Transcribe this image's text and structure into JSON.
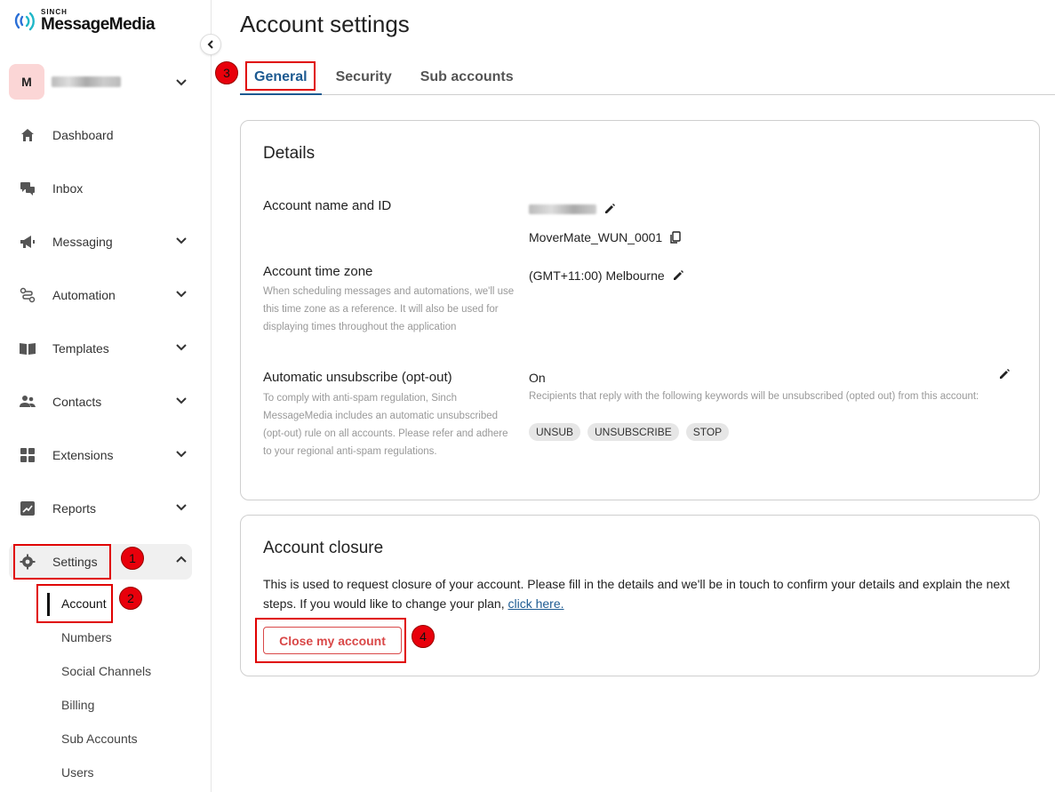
{
  "brand": {
    "small": "SINCH",
    "name": "MessageMedia"
  },
  "account_switcher": {
    "avatar_letter": "M"
  },
  "nav": {
    "items": [
      {
        "label": "Dashboard",
        "icon": "home-icon"
      },
      {
        "label": "Inbox",
        "icon": "chat-icon"
      },
      {
        "label": "Messaging",
        "icon": "megaphone-icon"
      },
      {
        "label": "Automation",
        "icon": "workflow-icon"
      },
      {
        "label": "Templates",
        "icon": "book-icon"
      },
      {
        "label": "Contacts",
        "icon": "people-icon"
      },
      {
        "label": "Extensions",
        "icon": "grid-icon"
      },
      {
        "label": "Reports",
        "icon": "chart-icon"
      },
      {
        "label": "Settings",
        "icon": "gear-icon"
      }
    ],
    "settings_sub": [
      "Account",
      "Numbers",
      "Social Channels",
      "Billing",
      "Sub Accounts",
      "Users"
    ]
  },
  "annotations": [
    "1",
    "2",
    "3",
    "4"
  ],
  "page": {
    "title": "Account settings",
    "tabs": [
      "General",
      "Security",
      "Sub accounts"
    ]
  },
  "details": {
    "title": "Details",
    "account_name_label": "Account name and ID",
    "account_id": "MoverMate_WUN_0001",
    "timezone_label": "Account time zone",
    "timezone_desc": "When scheduling messages and automations, we'll use this time zone as a reference. It will also be used for displaying times throughout the application",
    "timezone_value": "(GMT+11:00) Melbourne",
    "unsub_label": "Automatic unsubscribe (opt-out)",
    "unsub_desc": "To comply with anti-spam regulation, Sinch MessageMedia includes an automatic unsubscribed (opt-out) rule on all accounts. Please refer and adhere to your regional anti-spam regulations.",
    "unsub_value": "On",
    "unsub_value_desc": "Recipients that reply with the following keywords will be unsubscribed (opted out) from this account:",
    "keywords": [
      "UNSUB",
      "UNSUBSCRIBE",
      "STOP"
    ]
  },
  "closure": {
    "title": "Account closure",
    "text": "This is used to request closure of your account. Please fill in the details and we'll be in touch to confirm your details and explain the next steps. If you would like to change your plan, ",
    "link": "click here.",
    "button": "Close my account"
  },
  "colors": {
    "accent": "#1d5a91",
    "danger": "#d94848",
    "annotation": "#e00000"
  }
}
